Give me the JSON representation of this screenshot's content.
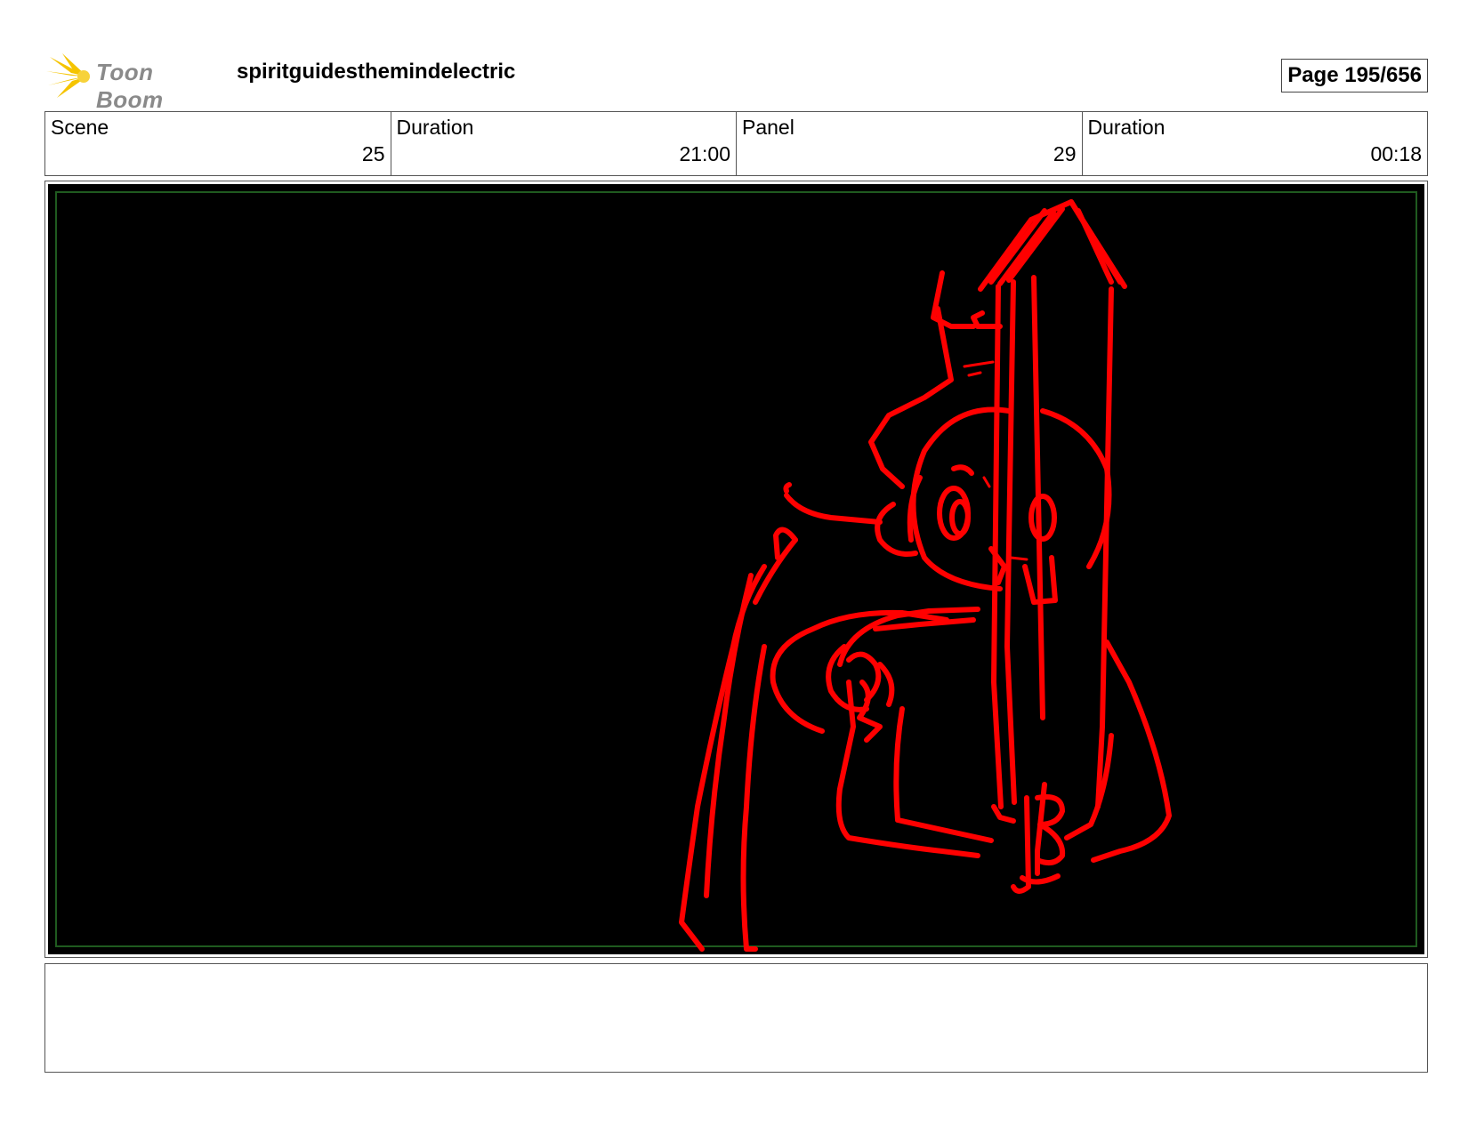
{
  "header": {
    "logo_text": "Toon Boom",
    "project_title": "spiritguidesthemindelectric",
    "page": "Page 195/656"
  },
  "info": {
    "scene_label": "Scene",
    "scene_value": "25",
    "scene_duration_label": "Duration",
    "scene_duration_value": "21:00",
    "panel_label": "Panel",
    "panel_value": "29",
    "panel_duration_label": "Duration",
    "panel_duration_value": "00:18"
  },
  "panel": {
    "background_color": "#000000",
    "sketch_color": "#ff0000",
    "safe_frame_color": "#1f5a1f"
  },
  "notes": {
    "text": ""
  }
}
